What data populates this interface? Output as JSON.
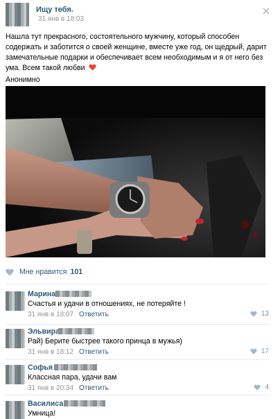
{
  "post": {
    "author": "Ищу тебя.",
    "date": "31 янв в 18:03",
    "text": "Нашла тут прекрасного, состоятельного мужчину, который способен содержать и заботится о своей женщине, вместе уже год, он щедрый, дарит замечательные подарки и обеспечивает всем необходимым и я от него без ума. Всем такой любви",
    "signature": "Анонимно",
    "likes_label": "Мне нравится",
    "likes_count": "101"
  },
  "comments": [
    {
      "name": "Марина",
      "text": "Счастья и удачи в отношениях, не потеряйте !",
      "date": "31 янв в 18:07",
      "reply": "Ответить",
      "likes": "13"
    },
    {
      "name": "Эльвира",
      "text": "Рай) Берите быстрее такого принца в мужья)",
      "date": "31 янв в 18:12",
      "reply": "Ответить",
      "likes": "17"
    },
    {
      "name": "Софья",
      "text": "Классная пара, удачи вам",
      "date": "31 янв в 20:34",
      "reply": "Ответить",
      "likes": "4"
    },
    {
      "name": "Василиса",
      "text": "Умница!",
      "date": "",
      "reply": "",
      "likes": ""
    }
  ],
  "colors": {
    "link": "#2b587a",
    "meta": "#939393",
    "heart": "#e8432b"
  }
}
